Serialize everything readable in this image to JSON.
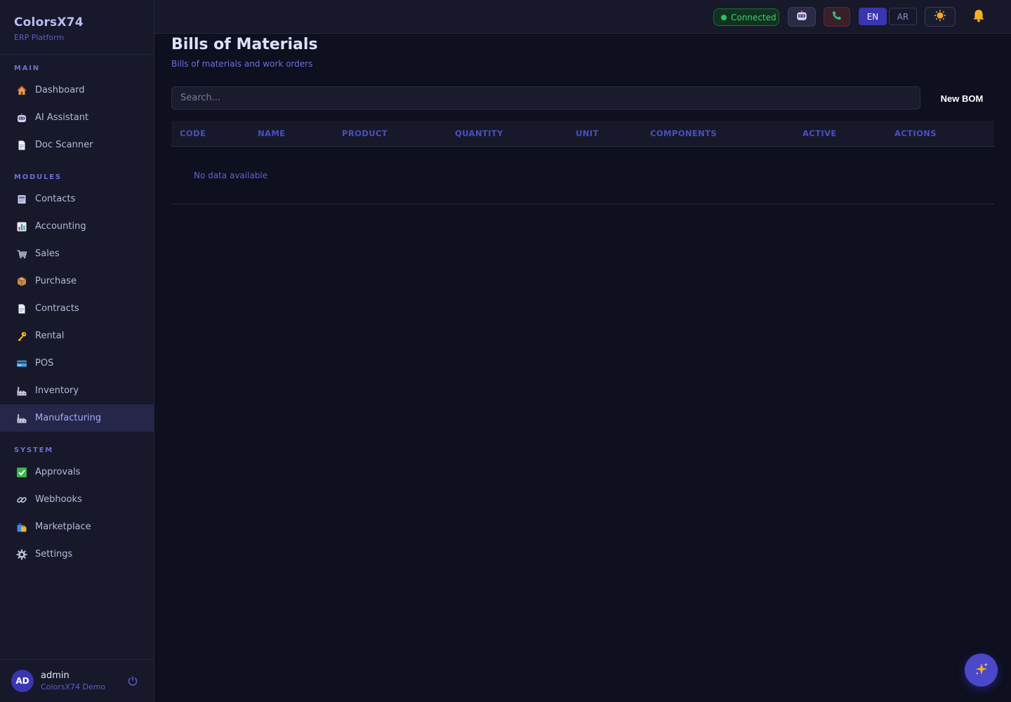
{
  "brand": {
    "name": "ColorsX74",
    "subtitle": "ERP Platform"
  },
  "sidebar": {
    "sections": [
      {
        "title": "MAIN",
        "items": [
          {
            "label": "Dashboard",
            "icon": "house-icon"
          },
          {
            "label": "AI Assistant",
            "icon": "robot-icon"
          },
          {
            "label": "Doc Scanner",
            "icon": "document-icon"
          }
        ]
      },
      {
        "title": "MODULES",
        "items": [
          {
            "label": "Contacts",
            "icon": "card-index-icon"
          },
          {
            "label": "Accounting",
            "icon": "bar-chart-icon"
          },
          {
            "label": "Sales",
            "icon": "cart-icon"
          },
          {
            "label": "Purchase",
            "icon": "package-icon"
          },
          {
            "label": "Contracts",
            "icon": "document-icon"
          },
          {
            "label": "Rental",
            "icon": "key-icon"
          },
          {
            "label": "POS",
            "icon": "credit-card-icon"
          },
          {
            "label": "Inventory",
            "icon": "factory-icon"
          },
          {
            "label": "Manufacturing",
            "icon": "factory-icon",
            "active": true
          }
        ]
      },
      {
        "title": "SYSTEM",
        "items": [
          {
            "label": "Approvals",
            "icon": "check-box-icon"
          },
          {
            "label": "Webhooks",
            "icon": "link-icon"
          },
          {
            "label": "Marketplace",
            "icon": "shopping-bags-icon"
          },
          {
            "label": "Settings",
            "icon": "gear-icon"
          }
        ]
      }
    ]
  },
  "user": {
    "initials": "AD",
    "name": "admin",
    "org": "ColorsX74 Demo"
  },
  "topbar": {
    "status": "Connected",
    "lang_en": "EN",
    "lang_ar": "AR",
    "active_lang": "EN"
  },
  "page": {
    "title": "Bills of Materials",
    "subtitle": "Bills of materials and work orders",
    "search_placeholder": "Search...",
    "new_button": "New BOM"
  },
  "table": {
    "columns": [
      "CODE",
      "NAME",
      "PRODUCT",
      "QUANTITY",
      "UNIT",
      "COMPONENTS",
      "ACTIVE",
      "ACTIONS"
    ],
    "empty_text": "No data available"
  },
  "colors": {
    "accent": "#4b49c9",
    "connected": "#3fd07a",
    "background": "#0e0f1f",
    "sidebar": "#171829"
  }
}
